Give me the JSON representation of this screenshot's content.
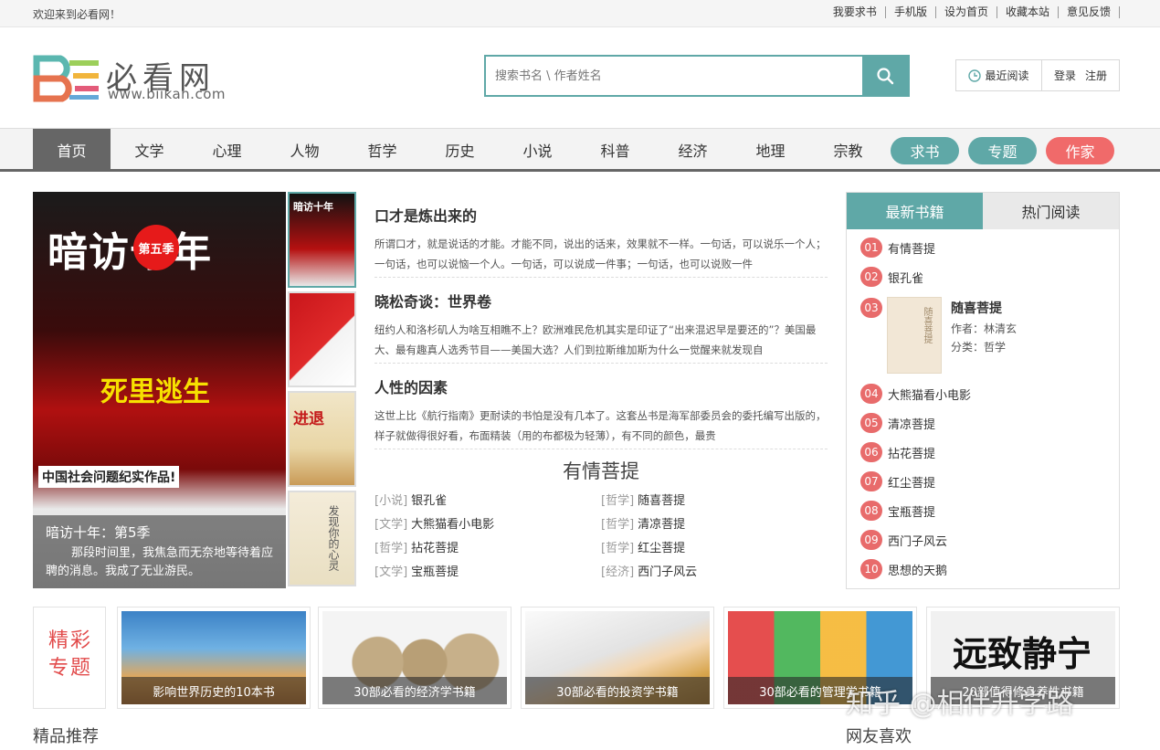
{
  "topbar": {
    "welcome": "欢迎来到必看网！",
    "links": [
      "我要求书",
      "手机版",
      "设为首页",
      "收藏本站",
      "意见反馈"
    ]
  },
  "logo": {
    "name": "必看网",
    "url": "www.biikan.com"
  },
  "search": {
    "placeholder": "搜索书名 \\ 作者姓名"
  },
  "user": {
    "recent": "最近阅读",
    "login": "登录",
    "register": "注册"
  },
  "nav": {
    "items": [
      "首页",
      "文学",
      "心理",
      "人物",
      "哲学",
      "历史",
      "小说",
      "科普",
      "经济",
      "地理",
      "宗教"
    ],
    "pills": [
      {
        "label": "求书",
        "color": "#5fa8a7"
      },
      {
        "label": "专题",
        "color": "#5fa8a7"
      },
      {
        "label": "作家",
        "color": "#f06a6a"
      }
    ]
  },
  "slider": {
    "cover_title": "暗访十年",
    "cover_badge": "第五季",
    "cover_sub": "死里逃生",
    "cover_tag": "中国社会问题纪实作品!",
    "caption_title": "暗访十年：第5季",
    "caption_desc": "那段时间里，我焦急而无奈地等待着应聘的消息。我成了无业游民。",
    "thumbs": [
      "暗访十年",
      "",
      "进退",
      "发现你的心灵"
    ]
  },
  "articles": [
    {
      "title": "口才是炼出来的",
      "text": "所谓口才，就是说话的才能。才能不同，说出的话来，效果就不一样。一句话，可以说乐一个人；一句话，也可以说恼一个人。一句话，可以说成一件事；一句话，也可以说败一件"
    },
    {
      "title": "晓松奇谈：世界卷",
      "text": "纽约人和洛杉矶人为啥互相瞧不上？欧洲难民危机其实是印证了“出来混迟早是要还的”？美国最大、最有趣真人选秀节目——美国大选？人们到拉斯维加斯为什么一觉醒来就发现自"
    },
    {
      "title": "人性的因素",
      "text": "这世上比《航行指南》更耐读的书怕是没有几本了。这套丛书是海军部委员会的委托编写出版的，样子就做得很好看，布面精装（用的布都极为轻薄），有不同的颜色，最贵"
    }
  ],
  "feature": {
    "title": "有情菩提",
    "list": [
      {
        "cat": "[小说]",
        "name": "银孔雀"
      },
      {
        "cat": "[哲学]",
        "name": "随喜菩提"
      },
      {
        "cat": "[文学]",
        "name": "大熊猫看小电影"
      },
      {
        "cat": "[哲学]",
        "name": "清凉菩提"
      },
      {
        "cat": "[哲学]",
        "name": "拈花菩提"
      },
      {
        "cat": "[哲学]",
        "name": "红尘菩提"
      },
      {
        "cat": "[文学]",
        "name": "宝瓶菩提"
      },
      {
        "cat": "[经济]",
        "name": "西门子风云"
      }
    ]
  },
  "rank": {
    "tabs": [
      "最新书籍",
      "热门阅读"
    ],
    "items": [
      {
        "num": "01",
        "name": "有情菩提"
      },
      {
        "num": "02",
        "name": "银孔雀"
      },
      {
        "num": "04",
        "name": "大熊猫看小电影"
      },
      {
        "num": "05",
        "name": "清凉菩提"
      },
      {
        "num": "06",
        "name": "拈花菩提"
      },
      {
        "num": "07",
        "name": "红尘菩提"
      },
      {
        "num": "08",
        "name": "宝瓶菩提"
      },
      {
        "num": "09",
        "name": "西门子风云"
      },
      {
        "num": "10",
        "name": "思想的天鹅"
      }
    ],
    "highlight": {
      "num": "03",
      "title": "随喜菩提",
      "author": "作者：林清玄",
      "category": "分类：哲学",
      "cover_text": "随喜菩提"
    }
  },
  "topics": {
    "special": "精彩专题",
    "items": [
      {
        "label": "影响世界历史的10本书"
      },
      {
        "label": "30部必看的经济学书籍"
      },
      {
        "label": "30部必看的投资学书籍"
      },
      {
        "label": "30部必看的管理学书籍"
      },
      {
        "label": "20部值得修身养性书籍"
      }
    ],
    "calligraphy": "远致静宁"
  },
  "sections": {
    "left": "精品推荐",
    "right": "网友喜欢"
  },
  "watermark": "知乎 @相伴升学路"
}
